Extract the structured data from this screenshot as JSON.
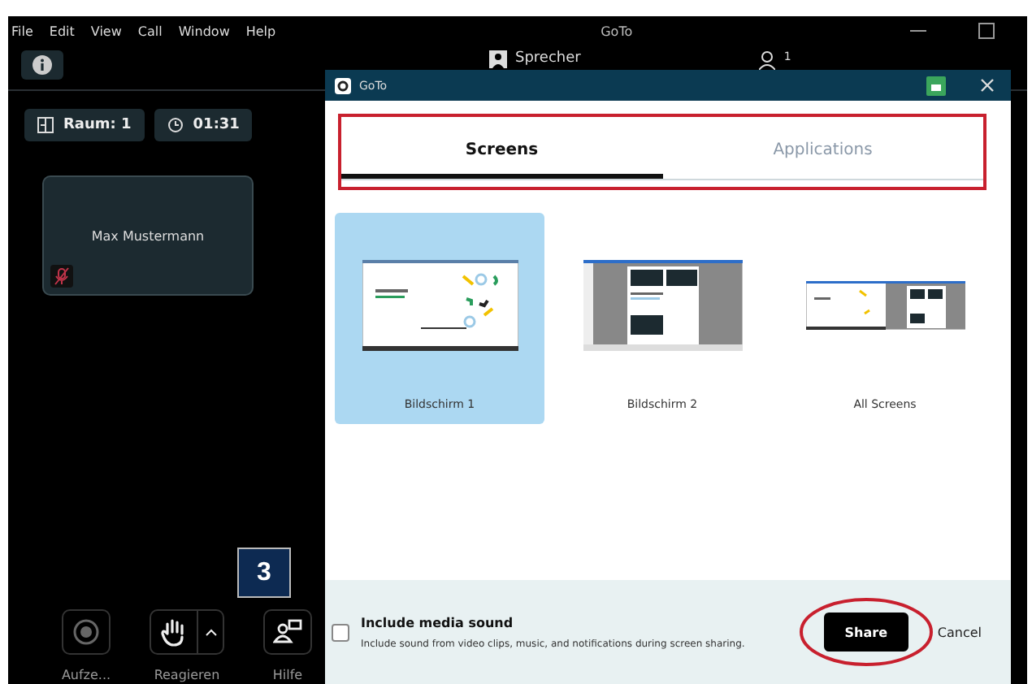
{
  "app": {
    "menu": [
      "File",
      "Edit",
      "View",
      "Call",
      "Window",
      "Help"
    ],
    "title": "GoTo",
    "view_label": "Sprecher",
    "participant_count": "1",
    "room": "Raum: 1",
    "timer": "01:31",
    "participant": {
      "name": "Max Mustermann",
      "muted": true
    },
    "controls": [
      {
        "kind": "record",
        "label": "Aufze..."
      },
      {
        "kind": "react",
        "label": "Reagieren"
      },
      {
        "kind": "help",
        "label": "Hilfe"
      }
    ]
  },
  "dialog": {
    "title": "GoTo",
    "tabs": [
      {
        "label": "Screens",
        "selected": true
      },
      {
        "label": "Applications",
        "selected": false
      }
    ],
    "screens": [
      {
        "kind": "desktop",
        "label": "Bildschirm 1",
        "selected": true
      },
      {
        "kind": "document",
        "label": "Bildschirm 2",
        "selected": false
      },
      {
        "kind": "combined",
        "label": "All Screens",
        "selected": false
      }
    ],
    "media_sound": {
      "label": "Include media sound",
      "description": "Include sound from video clips, music, and notifications during screen sharing.",
      "checked": false
    },
    "buttons": [
      {
        "kind": "primary",
        "label": "Share"
      },
      {
        "kind": "secondary",
        "label": "Cancel"
      }
    ]
  },
  "annotation": {
    "step": "3"
  }
}
